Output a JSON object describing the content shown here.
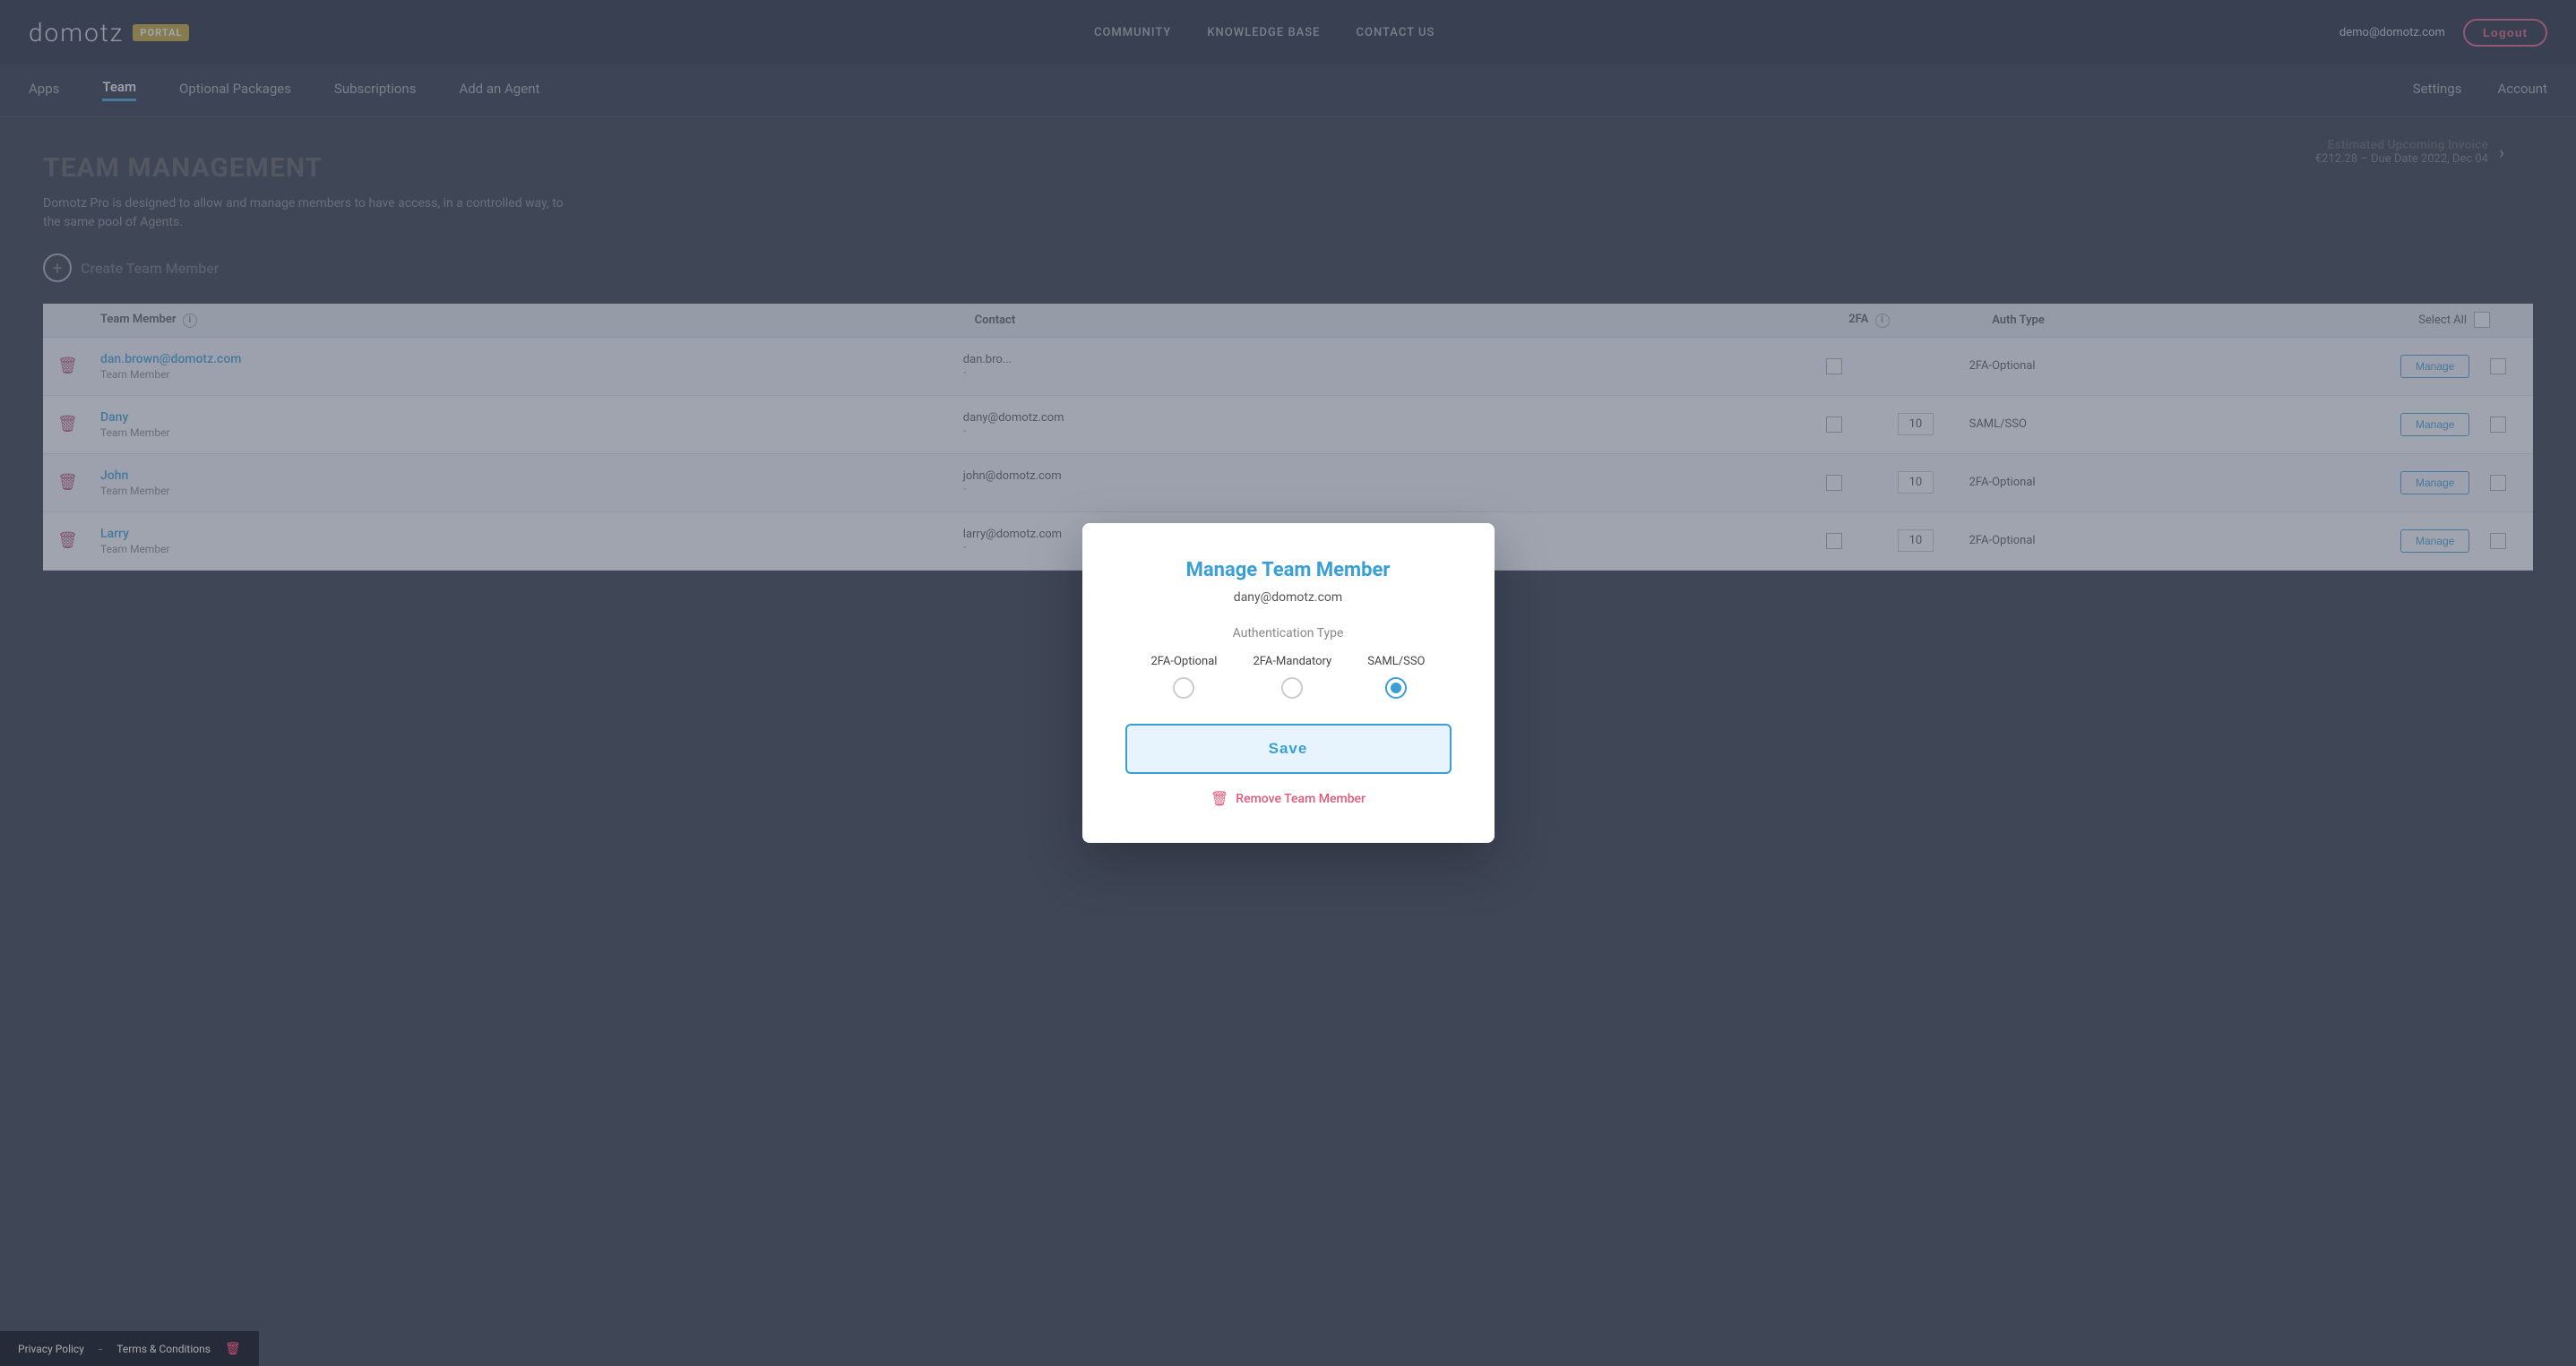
{
  "brand": {
    "name": "domotz",
    "badge": "PORTAL"
  },
  "topnav": {
    "links": [
      "COMMUNITY",
      "KNOWLEDGE BASE",
      "CONTACT US"
    ],
    "user_email": "demo@domotz.com",
    "logout_label": "Logout"
  },
  "secnav": {
    "left_items": [
      "Apps",
      "Team",
      "Optional Packages",
      "Subscriptions",
      "Add an Agent"
    ],
    "active_item": "Team",
    "right_items": [
      "Settings",
      "Account"
    ]
  },
  "invoice": {
    "title": "Estimated Upcoming Invoice",
    "amount": "€212.28 – Due Date 2022, Dec 04"
  },
  "page": {
    "title": "TEAM MANAGEMENT",
    "description": "Domotz Pro is designed to allow and manage members to have access, in a controlled way, to the same pool of Agents.",
    "create_label": "Create Team Member"
  },
  "table": {
    "headers": {
      "member": "Team Member",
      "contact": "Contact",
      "twofa": "2FA",
      "authtype": "Auth Type",
      "select_all": "Select All"
    },
    "rows": [
      {
        "email": "dan.brown@domotz.com",
        "role": "Team Member",
        "contact_email": "dan.bro...",
        "contact_dash": "-",
        "has_2fa": false,
        "agents": "",
        "auth_type": "2FA-Optional",
        "manage_label": "Manage"
      },
      {
        "email": "Dany",
        "role": "Team Member",
        "contact_email": "dany@domotz.com",
        "contact_dash": "-",
        "has_2fa": false,
        "agents": "10",
        "auth_type": "SAML/SSO",
        "manage_label": "Manage"
      },
      {
        "email": "John",
        "role": "Team Member",
        "contact_email": "john@domotz.com",
        "contact_dash": "-",
        "has_2fa": false,
        "agents": "10",
        "auth_type": "2FA-Optional",
        "manage_label": "Manage"
      },
      {
        "email": "Larry",
        "role": "Team Member",
        "contact_email": "larry@domotz.com",
        "contact_dash": "-",
        "has_2fa": false,
        "agents": "10",
        "auth_type": "2FA-Optional",
        "manage_label": "Manage"
      }
    ]
  },
  "modal": {
    "title": "Manage Team Member",
    "member_email": "dany@domotz.com",
    "auth_type_label": "Authentication Type",
    "auth_options": [
      {
        "id": "2fa-optional",
        "label": "2FA-Optional",
        "selected": false
      },
      {
        "id": "2fa-mandatory",
        "label": "2FA-Mandatory",
        "selected": false
      },
      {
        "id": "saml-sso",
        "label": "SAML/SSO",
        "selected": true
      }
    ],
    "save_label": "Save",
    "remove_label": "Remove Team Member"
  },
  "footer": {
    "privacy_label": "Privacy Policy",
    "terms_label": "Terms & Conditions"
  }
}
